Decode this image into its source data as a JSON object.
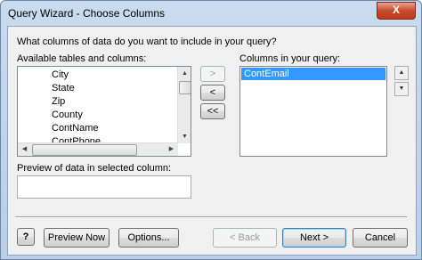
{
  "window": {
    "title": "Query Wizard - Choose Columns",
    "close_glyph": "X"
  },
  "prompt": "What columns of data do you want to include in your query?",
  "available": {
    "label": "Available tables and columns:",
    "items": [
      "City",
      "State",
      "Zip",
      "County",
      "ContName",
      "ContPhone"
    ]
  },
  "query": {
    "label": "Columns in your query:",
    "items": [
      "ContEmail"
    ]
  },
  "move_buttons": {
    "add": ">",
    "remove": "<",
    "remove_all": "<<"
  },
  "preview": {
    "label": "Preview of data in selected column:",
    "value": ""
  },
  "buttons": {
    "help": "?",
    "preview_now": "Preview Now",
    "options": "Options...",
    "back": "< Back",
    "next": "Next >",
    "cancel": "Cancel"
  }
}
